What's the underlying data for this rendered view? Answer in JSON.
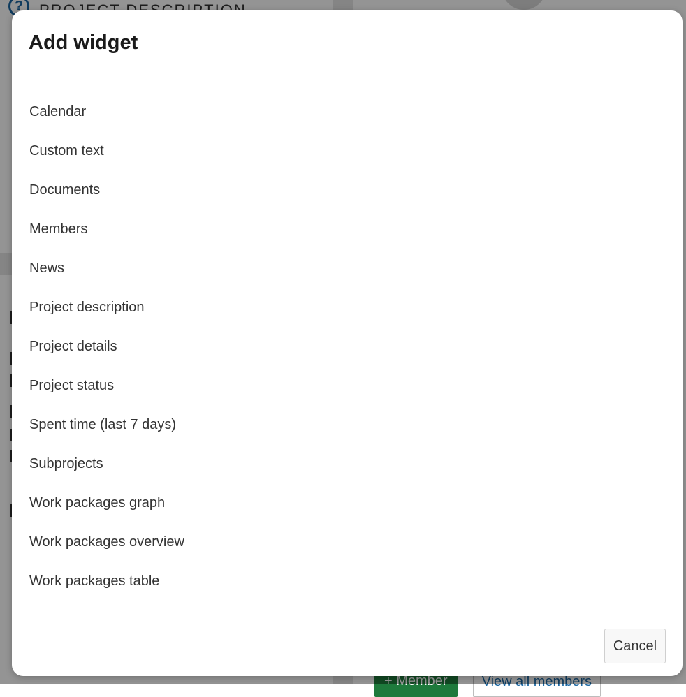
{
  "background": {
    "left_widget_title": "PROJECT DESCRIPTION",
    "help_icon": "?",
    "member_button_label": "+ Member",
    "view_all_members_label": "View all members"
  },
  "modal": {
    "title": "Add widget",
    "widgets": [
      "Calendar",
      "Custom text",
      "Documents",
      "Members",
      "News",
      "Project description",
      "Project details",
      "Project status",
      "Spent time (last 7 days)",
      "Subprojects",
      "Work packages graph",
      "Work packages overview",
      "Work packages table"
    ],
    "cancel_label": "Cancel"
  },
  "colors": {
    "accent_blue": "#1a67a3",
    "member_green": "#1e7a3c",
    "overlay": "rgba(0,0,0,0.42)"
  },
  "icons": [
    "help-icon",
    "add-icon",
    "members-icon"
  ]
}
